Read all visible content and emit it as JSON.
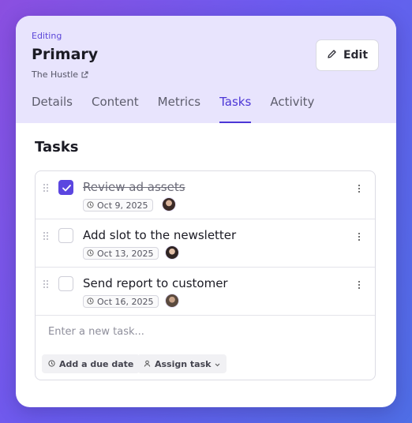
{
  "header": {
    "kicker": "Editing",
    "title": "Primary",
    "source": "The Hustle",
    "edit_label": "Edit"
  },
  "tabs": [
    {
      "label": "Details"
    },
    {
      "label": "Content"
    },
    {
      "label": "Metrics"
    },
    {
      "label": "Tasks",
      "active": true
    },
    {
      "label": "Activity"
    }
  ],
  "section": {
    "title": "Tasks"
  },
  "tasks": [
    {
      "title": "Review ad assets",
      "done": true,
      "due": "Oct 9, 2025"
    },
    {
      "title": "Add slot to the newsletter",
      "done": false,
      "due": "Oct 13, 2025"
    },
    {
      "title": "Send report to customer",
      "done": false,
      "due": "Oct 16, 2025"
    }
  ],
  "composer": {
    "placeholder": "Enter a new task...",
    "due_label": "Add a due date",
    "assign_label": "Assign task"
  },
  "colors": {
    "accent": "#4c36d6",
    "header_bg": "#e8e4fd"
  }
}
